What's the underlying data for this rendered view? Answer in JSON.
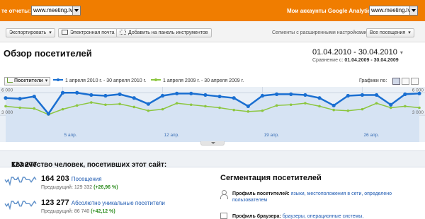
{
  "topbar": {
    "left_label": "те отчеты:",
    "left_select": "www.meeting.lv",
    "right_label": "Мои аккаунты Google Analytics:",
    "right_select": "www.meeting.lv",
    "bg_color": "#f07d00"
  },
  "toolbar": {
    "export_label": "Экспортировать",
    "email_label": "Электронная почта",
    "dashboard_label": "Добавить на панель инструментов",
    "segments_label": "Сегменты с расширенными настройками:",
    "segments_value": "Все посещения"
  },
  "overview": {
    "title": "Обзор посетителей",
    "date_range": "01.04.2010 - 30.04.2010",
    "compare_prefix": "Сравнение с:",
    "compare_range": "01.04.2009 - 30.04.2009"
  },
  "legend": {
    "metric": "Посетители",
    "series1": "1 апреля 2010 г. - 30 апреля 2010 г.",
    "series2": "1 апреля 2009 г. - 30 апреля 2009 г.",
    "graph_by": "Графики по:"
  },
  "chart_data": {
    "type": "line",
    "x": [
      "1 апр.",
      "2 апр.",
      "3 апр.",
      "4 апр.",
      "5 апр.",
      "6 апр.",
      "7 апр.",
      "8 апр.",
      "9 апр.",
      "10 апр.",
      "11 апр.",
      "12 апр.",
      "13 апр.",
      "14 апр.",
      "15 апр.",
      "16 апр.",
      "17 апр.",
      "18 апр.",
      "19 апр.",
      "20 апр.",
      "21 апр.",
      "22 апр.",
      "23 апр.",
      "24 апр.",
      "25 апр.",
      "26 апр.",
      "27 апр.",
      "28 апр.",
      "29 апр.",
      "30 апр."
    ],
    "x_tick_labels": [
      "5 апр.",
      "12 апр.",
      "19 апр.",
      "26 апр."
    ],
    "x_tick_index": [
      4,
      11,
      18,
      25
    ],
    "y_tick_labels": [
      "6 000",
      "3 000"
    ],
    "y_tick_values": [
      6000,
      3000
    ],
    "ylim": [
      0,
      6400
    ],
    "series": [
      {
        "name": "1 апреля 2010 г. - 30 апреля 2010 г.",
        "color": "#1a6fd1",
        "values": [
          5300,
          5200,
          5500,
          3200,
          6000,
          6000,
          5700,
          5600,
          5800,
          5300,
          4500,
          5600,
          5900,
          5900,
          5700,
          5500,
          5300,
          4200,
          5600,
          5800,
          5800,
          5700,
          5300,
          4300,
          5600,
          5700,
          5700,
          4400,
          5800,
          5900
        ]
      },
      {
        "name": "1 апреля 2009 г. - 30 апреля 2009 г.",
        "color": "#8cc63f",
        "values": [
          4200,
          4000,
          3900,
          3100,
          3800,
          4300,
          4700,
          4400,
          4500,
          4100,
          3600,
          3800,
          4600,
          4400,
          4200,
          4000,
          3700,
          3500,
          3600,
          4300,
          4400,
          4600,
          4200,
          3700,
          3600,
          3800,
          4600,
          4000,
          4200,
          4000
        ]
      }
    ],
    "grid": true
  },
  "people": {
    "label": "Количество человек, посетивших этот сайт:",
    "value": "123 277"
  },
  "stats": [
    {
      "value": "164 203",
      "label": "Посещения",
      "prev_label": "Предыдущий:",
      "prev_value": "129 332",
      "change": "(+26,96 %)",
      "spark": [
        5,
        4,
        5,
        3,
        6,
        6,
        5,
        5,
        6,
        4,
        4,
        6,
        6,
        5,
        5,
        5,
        4,
        5,
        6,
        5
      ]
    },
    {
      "value": "123 277",
      "label": "Абсолютно уникальные посетители",
      "prev_label": "Предыдущий:",
      "prev_value": "86 740",
      "change": "(+42,12 %)",
      "spark": [
        5,
        4,
        5,
        3,
        6,
        6,
        5,
        5,
        6,
        4,
        4,
        6,
        6,
        5,
        5,
        5,
        4,
        5,
        6,
        5
      ]
    }
  ],
  "segmentation": {
    "title": "Сегментация посетителей",
    "profile_label": "Профиль посетителей:",
    "profile_links": "языки, местоположения в сети, определено пользователем",
    "browser_label": "Профиль браузера:",
    "browser_links": "браузеры, операционные системы,"
  }
}
